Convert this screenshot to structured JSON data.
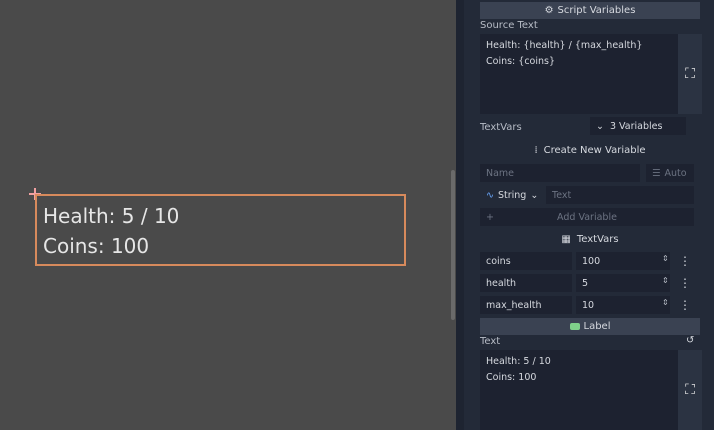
{
  "viewport": {
    "label_lines": [
      "Health: 5 / 10",
      "Coins: 100"
    ]
  },
  "inspector": {
    "script_variables_header": "Script Variables",
    "source_text_label": "Source Text",
    "source_text_lines": [
      "Health: {health} / {max_health}",
      "Coins: {coins}"
    ],
    "textvars_label": "TextVars",
    "textvars_count": "3 Variables",
    "create_new_variable": "Create New Variable",
    "name_placeholder": "Name",
    "auto_label": "Auto",
    "type_selected": "String",
    "text_placeholder": "Text",
    "add_variable": "Add Variable",
    "textvars_section": "TextVars",
    "variables": [
      {
        "name": "coins",
        "value": "100"
      },
      {
        "name": "health",
        "value": "5"
      },
      {
        "name": "max_health",
        "value": "10"
      }
    ],
    "label_header": "Label",
    "text_label": "Text",
    "text_lines": [
      "Health: 5 / 10",
      "Coins: 100"
    ]
  },
  "colors": {
    "selection_border": "#d78a5c",
    "panel_bg": "#232a38",
    "viewport_bg": "#4a4a4a",
    "label_icon": "#7fd08a"
  },
  "icons": [
    "gear-icon",
    "expand-icon",
    "plus-icon",
    "list-icon",
    "string-type-icon",
    "chevron-down-icon",
    "spinner-icon",
    "kebab-icon",
    "refresh-icon",
    "label-node-icon",
    "textvars-icon",
    "add-variable-icon"
  ]
}
